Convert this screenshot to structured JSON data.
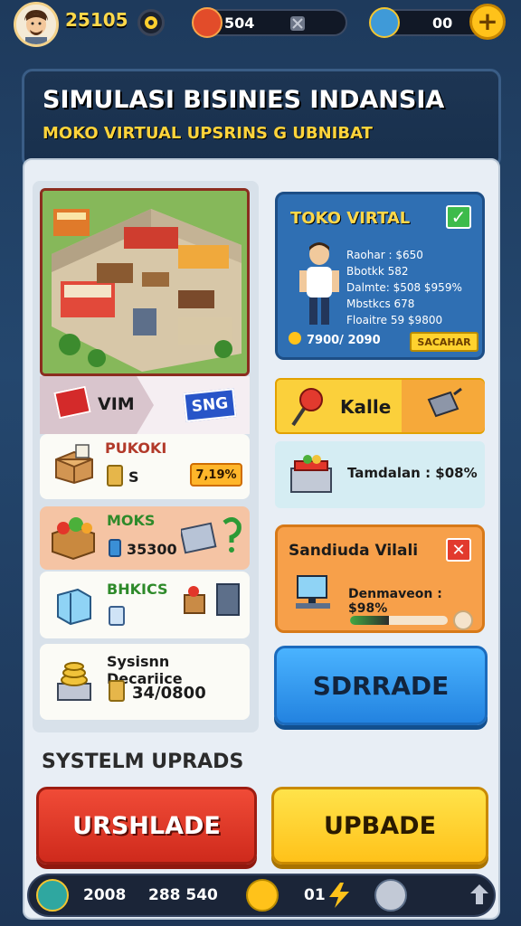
{
  "hud": {
    "coins": "25105",
    "resource1": "504",
    "resource2": "00",
    "plus": "+",
    "colors": {
      "gold": "#ffd84a",
      "pill": "#111826"
    }
  },
  "banner": {
    "title": "SIMULASI BISINIES INDANSIA",
    "subtitle": "MOKO VIRTUAL UPSRINS G UBNIBAT"
  },
  "left": {
    "tag1": "VIM",
    "tag2": "SNG",
    "cards": [
      {
        "label": "PUKOKI",
        "value": "S",
        "badge": "7,19%"
      },
      {
        "label": "MOKS",
        "value": "35300"
      },
      {
        "label": "BHKICS",
        "value": ""
      },
      {
        "label": "Sysisnn Decariice",
        "value": "34/0800"
      }
    ]
  },
  "toko": {
    "title": "TOKO VIRTAL",
    "check": "✓",
    "stats": [
      "Raohar : $650",
      "Bbotkk 582",
      "Dalmte: $508 $959%",
      "Mbstkcs 678",
      "Floaitre 59 $9800"
    ],
    "footer": "7900/ 2090",
    "button": "SACAHAR"
  },
  "kalle": {
    "label": "Kalle"
  },
  "tambah": {
    "label": "Tamdalan : $08%"
  },
  "sandu": {
    "title": "Sandiuda Vilali",
    "close": "✕",
    "line": "Denmaveon : $98%",
    "progress": 0.4
  },
  "buttons": {
    "upgrade_blue": "SDRRADE",
    "system_title": "SYSTELM UPRADS",
    "red": "URSHLADE",
    "yellow": "UPBADE"
  },
  "bottom": {
    "stat1": "2008",
    "stat2": "288 540",
    "stat3": "01"
  }
}
